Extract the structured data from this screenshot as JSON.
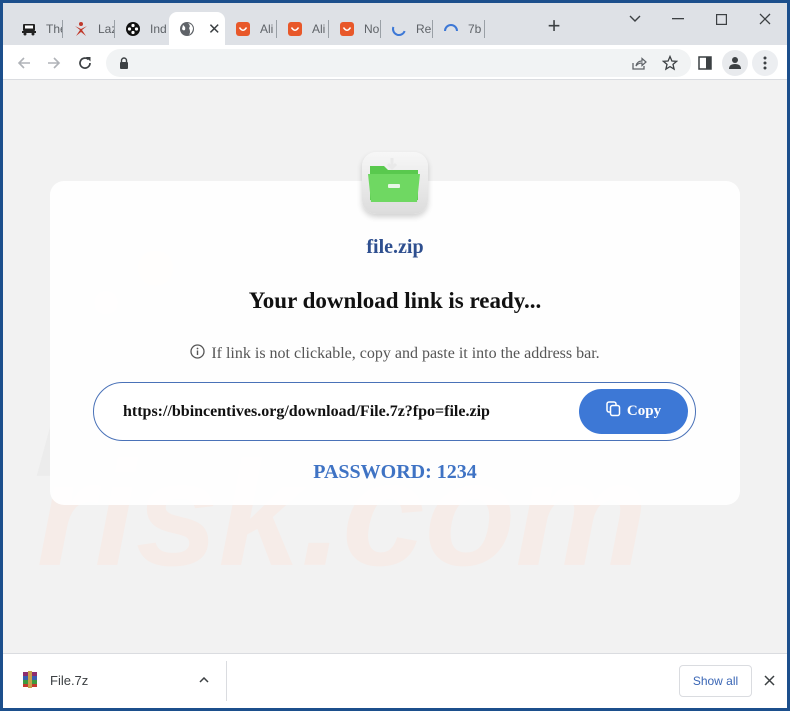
{
  "browser": {
    "tabs": [
      {
        "title": "The",
        "icon": "vintage-car-icon",
        "active": false
      },
      {
        "title": "Laz",
        "icon": "red-figure-icon",
        "active": false
      },
      {
        "title": "Ind",
        "icon": "film-reel-icon",
        "active": false
      },
      {
        "title": "",
        "icon": "globe-icon",
        "active": true
      },
      {
        "title": "Ali",
        "icon": "aliexpress-icon",
        "active": false
      },
      {
        "title": "Ali",
        "icon": "aliexpress-icon",
        "active": false
      },
      {
        "title": "No",
        "icon": "aliexpress-icon",
        "active": false
      },
      {
        "title": "Re",
        "icon": "loading-spinner-icon",
        "active": false
      },
      {
        "title": "7b",
        "icon": "loading-spinner-icon",
        "active": false
      }
    ],
    "new_tab_label": "+",
    "address_bar": {
      "url": "",
      "secure": true
    },
    "colors": {
      "frame": "#1c4f8c",
      "tabstrip": "#dee1e6",
      "accent": "#3d78d6"
    }
  },
  "page": {
    "file_name": "file.zip",
    "headline": "Your download link is ready...",
    "hint": "If link is not clickable, copy and paste it into the address bar.",
    "link_url": "https://bbincentives.org/download/File.7z?fpo=file.zip",
    "copy_label": "Copy",
    "password_text": "PASSWORD: 1234",
    "watermark": "pcrisk.com"
  },
  "download_bar": {
    "file_name": "File.7z",
    "show_all_label": "Show all"
  }
}
